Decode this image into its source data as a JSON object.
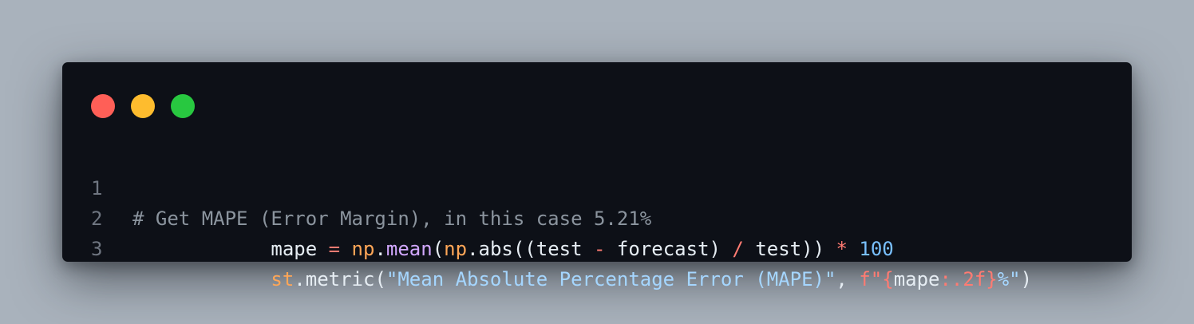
{
  "colors": {
    "background": "#a9b2bc",
    "editor": "#0d1017",
    "close": "#ff5f57",
    "minimize": "#febc2e",
    "maximize": "#28c840",
    "comment": "#8b949e",
    "keyword": "#ff7b72",
    "variable": "#ffa657",
    "function": "#d2a8ff",
    "string": "#a5d6ff",
    "number": "#79c0ff",
    "plain": "#e6edf3"
  },
  "window": {
    "buttons": [
      "close",
      "minimize",
      "maximize"
    ]
  },
  "code": {
    "lines": [
      {
        "number": "1",
        "tokens": [
          {
            "text": "# Get MAPE (Error Margin), in this case 5.21%",
            "type": "comment"
          }
        ]
      },
      {
        "number": "2",
        "tokens": [
          {
            "text": "            ",
            "type": "plain"
          },
          {
            "text": "mape",
            "type": "plain"
          },
          {
            "text": " ",
            "type": "plain"
          },
          {
            "text": "=",
            "type": "keyword"
          },
          {
            "text": " ",
            "type": "plain"
          },
          {
            "text": "np",
            "type": "variable"
          },
          {
            "text": ".",
            "type": "plain"
          },
          {
            "text": "mean",
            "type": "function"
          },
          {
            "text": "(",
            "type": "plain"
          },
          {
            "text": "np",
            "type": "variable"
          },
          {
            "text": ".abs((test ",
            "type": "plain"
          },
          {
            "text": "-",
            "type": "keyword"
          },
          {
            "text": " forecast) ",
            "type": "plain"
          },
          {
            "text": "/",
            "type": "keyword"
          },
          {
            "text": " test)) ",
            "type": "plain"
          },
          {
            "text": "*",
            "type": "keyword"
          },
          {
            "text": " ",
            "type": "plain"
          },
          {
            "text": "100",
            "type": "number"
          }
        ]
      },
      {
        "number": "3",
        "tokens": [
          {
            "text": "            ",
            "type": "plain"
          },
          {
            "text": "st",
            "type": "variable"
          },
          {
            "text": ".metric(",
            "type": "plain"
          },
          {
            "text": "\"Mean Absolute Percentage Error (MAPE)\"",
            "type": "string"
          },
          {
            "text": ", ",
            "type": "plain"
          },
          {
            "text": "f\"",
            "type": "keyword"
          },
          {
            "text": "{",
            "type": "keyword"
          },
          {
            "text": "mape",
            "type": "plain"
          },
          {
            "text": ":.2f",
            "type": "keyword"
          },
          {
            "text": "}",
            "type": "keyword"
          },
          {
            "text": "%\"",
            "type": "string"
          },
          {
            "text": ")",
            "type": "plain"
          }
        ]
      }
    ]
  }
}
